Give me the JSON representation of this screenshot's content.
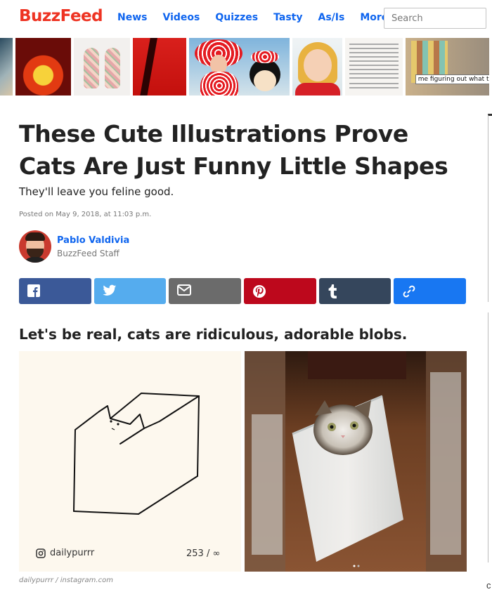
{
  "header": {
    "logo": "BuzzFeed",
    "nav": [
      {
        "label": "News"
      },
      {
        "label": "Videos"
      },
      {
        "label": "Quizzes"
      },
      {
        "label": "Tasty"
      },
      {
        "label": "As/Is"
      },
      {
        "label": "More"
      }
    ],
    "search_placeholder": "Search"
  },
  "thumb_strip": {
    "caption_last": "me figuring out what to"
  },
  "article": {
    "title": "These Cute Illustrations Prove Cats Are Just Funny Little Shapes",
    "subtitle": "They'll leave you feline good.",
    "posted": "Posted on May 9, 2018, at 11:03 p.m.",
    "author_name": "Pablo Valdivia",
    "author_role": "BuzzFeed Staff",
    "lede": "Let's be real, cats are ridiculous, adorable blobs.",
    "instagram_handle": "dailypurrr",
    "instagram_count": "253 / ∞",
    "image_credit": "dailypurrr / instagram.com"
  },
  "share_buttons": [
    {
      "network": "facebook",
      "icon": "facebook-icon",
      "color": "#3b5998"
    },
    {
      "network": "twitter",
      "icon": "twitter-icon",
      "color": "#55acee"
    },
    {
      "network": "email",
      "icon": "mail-icon",
      "color": "#6b6b6b"
    },
    {
      "network": "pinterest",
      "icon": "pinterest-icon",
      "color": "#bd081c"
    },
    {
      "network": "tumblr",
      "icon": "tumblr-icon",
      "color": "#35465c"
    },
    {
      "network": "link",
      "icon": "link-icon",
      "color": "#1877f2"
    }
  ],
  "colors": {
    "brand": "#ee3322",
    "link": "#0f65ef"
  }
}
